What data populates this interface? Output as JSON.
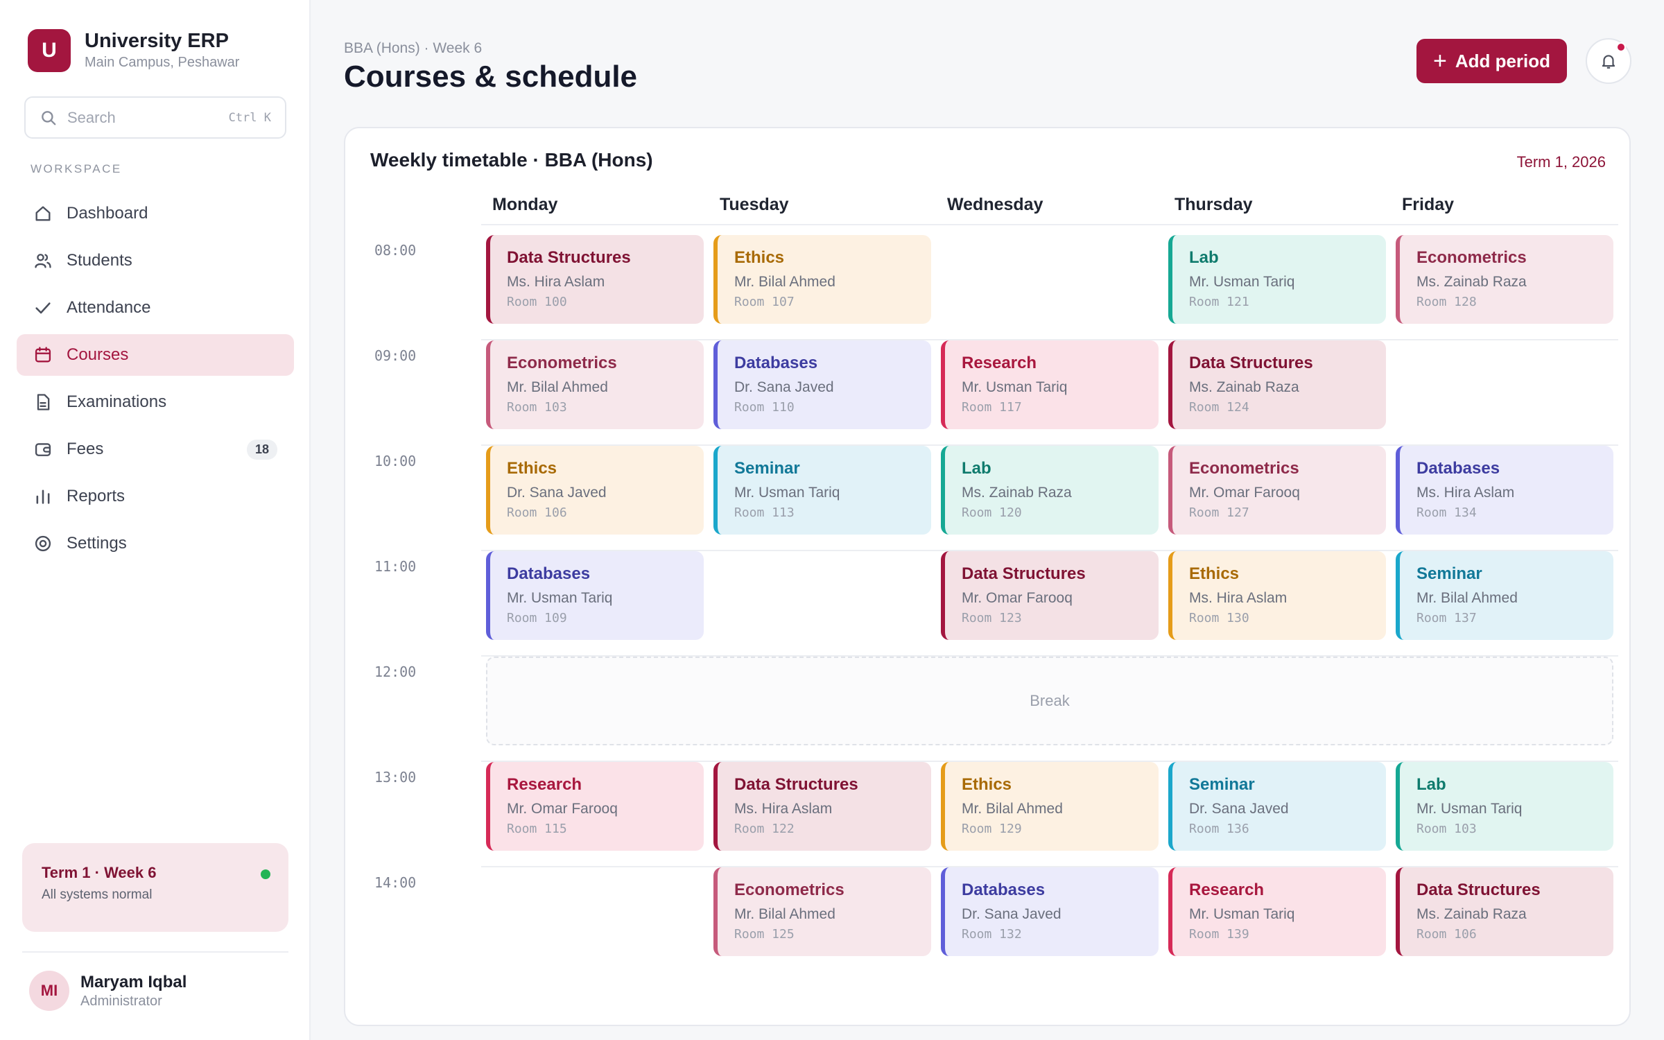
{
  "brand": {
    "logo_letter": "U",
    "title": "University ERP",
    "subtitle": "Main Campus, Peshawar"
  },
  "search": {
    "placeholder": "Search",
    "shortcut": "Ctrl K"
  },
  "nav": {
    "heading": "WORKSPACE",
    "items": [
      {
        "label": "Dashboard",
        "icon": "home-icon"
      },
      {
        "label": "Students",
        "icon": "users-icon"
      },
      {
        "label": "Attendance",
        "icon": "check-icon"
      },
      {
        "label": "Courses",
        "icon": "calendar-icon",
        "active": true
      },
      {
        "label": "Examinations",
        "icon": "document-icon"
      },
      {
        "label": "Fees",
        "icon": "wallet-icon",
        "badge": "18"
      },
      {
        "label": "Reports",
        "icon": "bar-chart-icon"
      },
      {
        "label": "Settings",
        "icon": "gear-icon"
      }
    ]
  },
  "status_card": {
    "title": "Term 1 · Week 6",
    "subtitle": "All systems normal",
    "status_color": "#22b455"
  },
  "user": {
    "initials": "MI",
    "name": "Maryam Iqbal",
    "role": "Administrator"
  },
  "header": {
    "breadcrumb": "BBA (Hons) · Week 6",
    "title": "Courses & schedule",
    "add_button": "Add period"
  },
  "timetable": {
    "title": "Weekly timetable · BBA (Hons)",
    "term": "Term 1, 2026",
    "days": [
      "Monday",
      "Tuesday",
      "Wednesday",
      "Thursday",
      "Friday"
    ],
    "break_label": "Break",
    "rows": [
      {
        "time": "08:00",
        "slots": [
          {
            "course": "Data Structures",
            "teacher": "Ms. Hira Aslam",
            "room": "Room 100"
          },
          {
            "course": "Ethics",
            "teacher": "Mr. Bilal Ahmed",
            "room": "Room 107"
          },
          null,
          {
            "course": "Lab",
            "teacher": "Mr. Usman Tariq",
            "room": "Room 121"
          },
          {
            "course": "Econometrics",
            "teacher": "Ms. Zainab Raza",
            "room": "Room 128"
          }
        ]
      },
      {
        "time": "09:00",
        "slots": [
          {
            "course": "Econometrics",
            "teacher": "Mr. Bilal Ahmed",
            "room": "Room 103"
          },
          {
            "course": "Databases",
            "teacher": "Dr. Sana Javed",
            "room": "Room 110"
          },
          {
            "course": "Research",
            "teacher": "Mr. Usman Tariq",
            "room": "Room 117"
          },
          {
            "course": "Data Structures",
            "teacher": "Ms. Zainab Raza",
            "room": "Room 124"
          },
          null
        ]
      },
      {
        "time": "10:00",
        "slots": [
          {
            "course": "Ethics",
            "teacher": "Dr. Sana Javed",
            "room": "Room 106"
          },
          {
            "course": "Seminar",
            "teacher": "Mr. Usman Tariq",
            "room": "Room 113"
          },
          {
            "course": "Lab",
            "teacher": "Ms. Zainab Raza",
            "room": "Room 120"
          },
          {
            "course": "Econometrics",
            "teacher": "Mr. Omar Farooq",
            "room": "Room 127"
          },
          {
            "course": "Databases",
            "teacher": "Ms. Hira Aslam",
            "room": "Room 134"
          }
        ]
      },
      {
        "time": "11:00",
        "slots": [
          {
            "course": "Databases",
            "teacher": "Mr. Usman Tariq",
            "room": "Room 109"
          },
          null,
          {
            "course": "Data Structures",
            "teacher": "Mr. Omar Farooq",
            "room": "Room 123"
          },
          {
            "course": "Ethics",
            "teacher": "Ms. Hira Aslam",
            "room": "Room 130"
          },
          {
            "course": "Seminar",
            "teacher": "Mr. Bilal Ahmed",
            "room": "Room 137"
          }
        ]
      },
      {
        "time": "12:00",
        "is_break": true
      },
      {
        "time": "13:00",
        "slots": [
          {
            "course": "Research",
            "teacher": "Mr. Omar Farooq",
            "room": "Room 115"
          },
          {
            "course": "Data Structures",
            "teacher": "Ms. Hira Aslam",
            "room": "Room 122"
          },
          {
            "course": "Ethics",
            "teacher": "Mr. Bilal Ahmed",
            "room": "Room 129"
          },
          {
            "course": "Seminar",
            "teacher": "Dr. Sana Javed",
            "room": "Room 136"
          },
          {
            "course": "Lab",
            "teacher": "Mr. Usman Tariq",
            "room": "Room 103"
          }
        ]
      },
      {
        "time": "14:00",
        "slots": [
          null,
          {
            "course": "Econometrics",
            "teacher": "Mr. Bilal Ahmed",
            "room": "Room 125"
          },
          {
            "course": "Databases",
            "teacher": "Dr. Sana Javed",
            "room": "Room 132"
          },
          {
            "course": "Research",
            "teacher": "Mr. Usman Tariq",
            "room": "Room 139"
          },
          {
            "course": "Data Structures",
            "teacher": "Ms. Zainab Raza",
            "room": "Room 106"
          }
        ]
      }
    ]
  },
  "course_colors": {
    "Data Structures": "#a3163f",
    "Ethics": "#e59c1a",
    "Lab": "#16a894",
    "Econometrics": "#c65a7b",
    "Databases": "#5f5ed9",
    "Research": "#d62a57",
    "Seminar": "#1ba7cb"
  },
  "accent_color": "#a3163f"
}
